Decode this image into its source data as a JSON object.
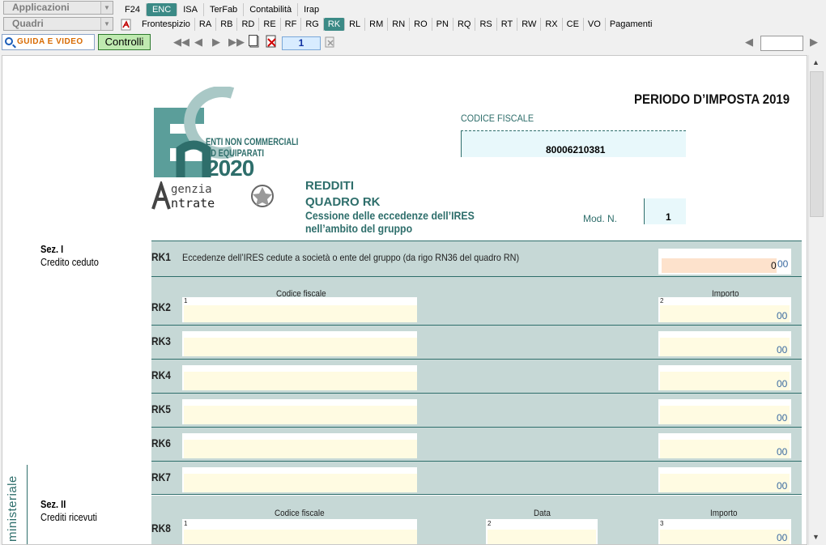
{
  "menu": {
    "applicazioni": "Applicazioni",
    "quadri": "Quadri",
    "top_tabs": [
      "F24",
      "ENC",
      "ISA",
      "TerFab",
      "Contabilità",
      "Irap"
    ],
    "top_selected": 1,
    "quadri_tabs": [
      "Frontespizio",
      "RA",
      "RB",
      "RD",
      "RE",
      "RF",
      "RG",
      "RK",
      "RL",
      "RM",
      "RN",
      "RO",
      "PN",
      "RQ",
      "RS",
      "RT",
      "RW",
      "RX",
      "CE",
      "VO",
      "Pagamenti"
    ],
    "quadri_selected": 7
  },
  "toolbar": {
    "guida": "GUIDA E VIDEO",
    "controlli": "Controlli",
    "page": "1"
  },
  "form": {
    "periodo": "PERIODO D’IMPOSTA 2019",
    "logo": {
      "line1": "ENTI NON COMMERCIALI",
      "line2": "ED EQUIPARATI",
      "year": "2020",
      "agenzia": "genzia",
      "entrate": "ntrate"
    },
    "codice_fiscale_label": "CODICE FISCALE",
    "codice_fiscale": "80006210381",
    "title": "REDDITI",
    "quadro": "QUADRO RK",
    "subtitle1": "Cessione delle eccedenze dell’IRES",
    "subtitle2": "nell’ambito del gruppo",
    "mod_label": "Mod. N.",
    "mod_value": "1",
    "sez1_title": "Sez. I",
    "sez1_sub": "Credito ceduto",
    "rk1_label": "RK1",
    "rk1_desc": "Eccedenze dell’IRES cedute a società o ente del gruppo (da rigo RN36 del quadro RN)",
    "rk1_value": "0",
    "cents": "00",
    "col_codice": "Codice fiscale",
    "col_importo": "Importo",
    "col_data": "Data",
    "rows_sez1": [
      "RK2",
      "RK3",
      "RK4",
      "RK5",
      "RK6",
      "RK7"
    ],
    "sez2_title": "Sez. II",
    "sez2_sub": "Crediti ricevuti",
    "rk8_label": "RK8",
    "side_label": "ministeriale",
    "n1": "1",
    "n2": "2",
    "n3": "3"
  }
}
